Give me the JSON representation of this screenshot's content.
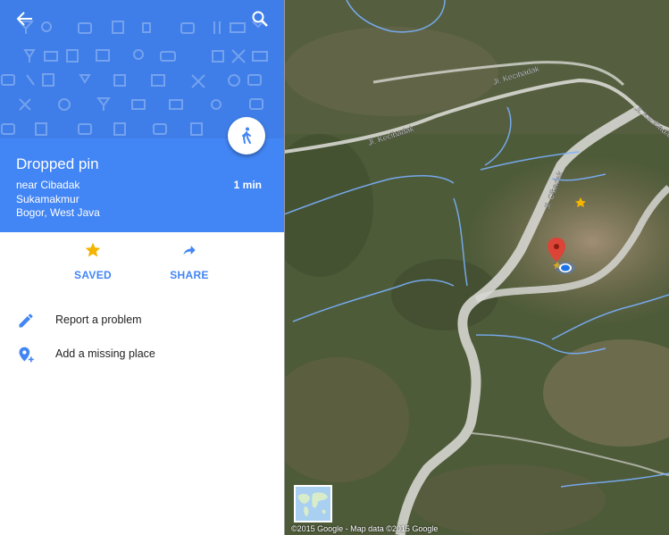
{
  "place": {
    "title": "Dropped pin",
    "address_lines": [
      "near Cibadak",
      "Sukamakmur",
      "Bogor, West Java"
    ],
    "eta": "1 min"
  },
  "actions": {
    "saved_label": "SAVED",
    "share_label": "SHARE"
  },
  "menu": {
    "report_label": "Report a problem",
    "add_place_label": "Add a missing place"
  },
  "map": {
    "road_labels": [
      "Jl. Kecibadak",
      "Jl. Kecibadak",
      "Jl. Cibadak",
      "Jl. Kecibadak"
    ],
    "attribution": "©2015 Google - Map data ©2015 Google"
  },
  "colors": {
    "header_blue": "#3f7ee8",
    "info_blue": "#4285f4",
    "saved_star": "#f4b400",
    "pin_red": "#db4437"
  },
  "icons": [
    "back-arrow-icon",
    "search-icon",
    "walking-icon",
    "star-icon",
    "share-icon",
    "pencil-icon",
    "add-location-icon"
  ]
}
